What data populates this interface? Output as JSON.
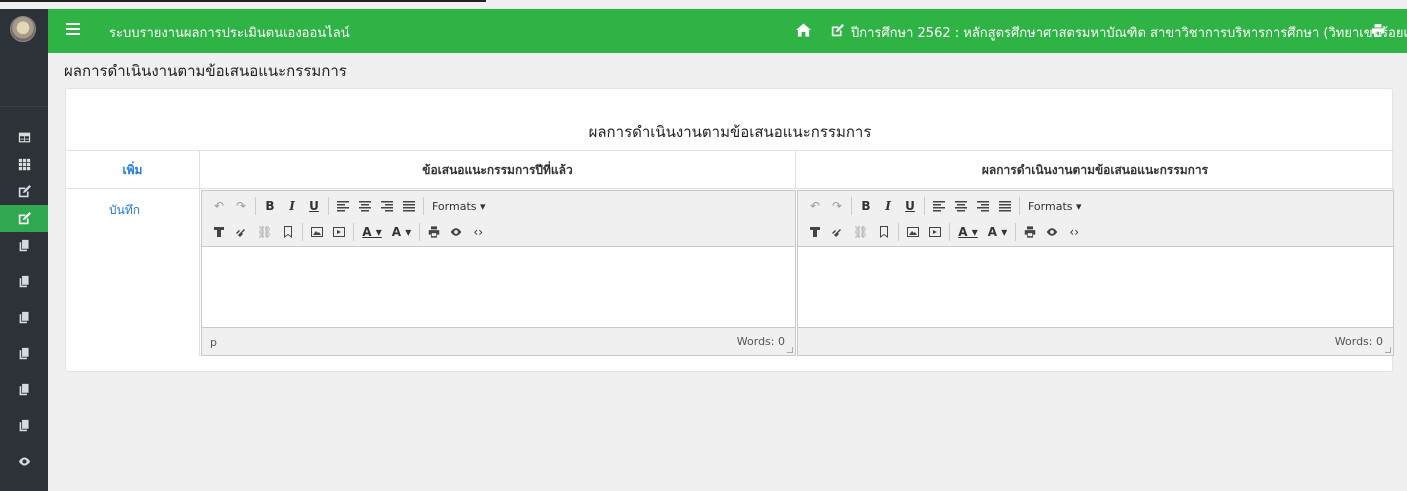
{
  "header": {
    "app_title": "ระบบรายงานผลการประเมินตนเองออนไลน์",
    "year_title": "ปีการศึกษา 2562 : หลักสูตรศึกษาศาสตรมหาบัณฑิต สาขาวิชาการบริหารการศึกษา (วิทยาเขตร้อยเอ็ด)"
  },
  "page": {
    "title": "ผลการดำเนินงานตามข้อเสนอแนะกรรมการ"
  },
  "card": {
    "title": "ผลการดำเนินงานตามข้อเสนอแนะกรรมการ",
    "columns": {
      "add": "เพิ่ม",
      "col1": "ข้อเสนอแนะกรรมการปีที่แล้ว",
      "col2": "ผลการดำเนินงานตามข้อเสนอแนะกรรมการ"
    },
    "save_label": "บันทึก"
  },
  "editor": {
    "bold": "B",
    "italic": "I",
    "underline": "U",
    "formats": "Formats ▾",
    "text_color": "A ▾",
    "bg_color": "A ▾",
    "path": "p",
    "words": "Words: 0"
  }
}
